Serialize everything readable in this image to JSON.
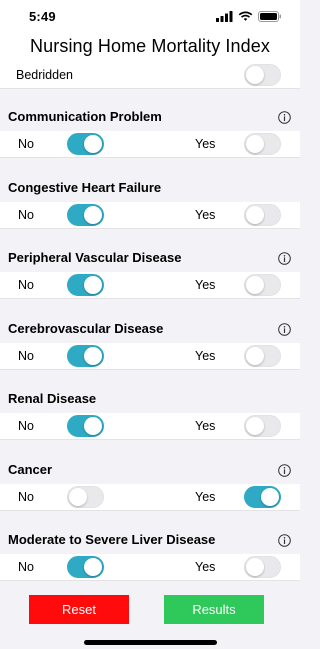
{
  "status": {
    "time": "5:49"
  },
  "header": {
    "title": "Nursing Home Mortality Index"
  },
  "top_row": {
    "label": "Bedridden",
    "toggle_on": false
  },
  "sections": [
    {
      "title": "Communication Problem",
      "info": true,
      "no_on": true,
      "yes_on": false
    },
    {
      "title": "Congestive Heart Failure",
      "info": false,
      "no_on": true,
      "yes_on": false
    },
    {
      "title": "Peripheral Vascular Disease",
      "info": true,
      "no_on": true,
      "yes_on": false
    },
    {
      "title": "Cerebrovascular Disease",
      "info": true,
      "no_on": true,
      "yes_on": false
    },
    {
      "title": "Renal Disease",
      "info": false,
      "no_on": true,
      "yes_on": false
    },
    {
      "title": "Cancer",
      "info": true,
      "no_on": false,
      "yes_on": true
    },
    {
      "title": "Moderate to Severe Liver Disease",
      "info": true,
      "no_on": true,
      "yes_on": false
    }
  ],
  "labels": {
    "no": "No",
    "yes": "Yes"
  },
  "buttons": {
    "reset": "Reset",
    "results": "Results"
  },
  "colors": {
    "toggle_on": "#2eaac4",
    "reset": "#ff0b0b",
    "results": "#2ec95a"
  }
}
